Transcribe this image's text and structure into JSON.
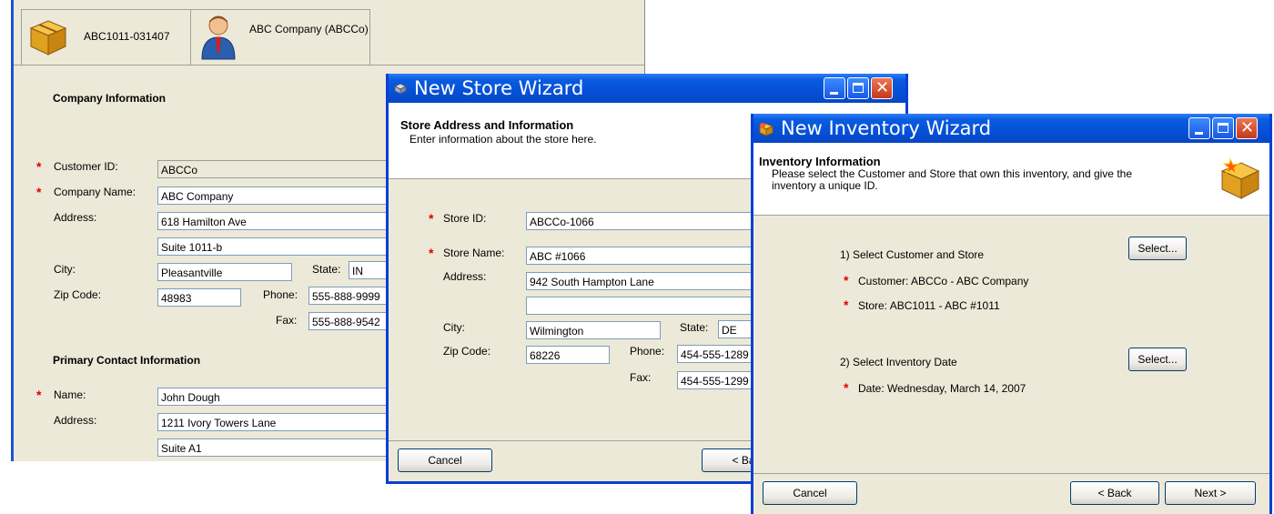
{
  "bg_app": {
    "tabs": [
      {
        "label": "ABC1011-031407",
        "icon": "box-icon"
      },
      {
        "label": "ABC Company (ABCCo)",
        "icon": "person-icon"
      }
    ],
    "company_section": "Company Information",
    "customer_id_label": "Customer ID:",
    "customer_id_value": "ABCCo",
    "company_name_label": "Company Name:",
    "company_name_value": "ABC Company",
    "address_label": "Address:",
    "address1": "618 Hamilton Ave",
    "address2": "Suite 1011-b",
    "city_label": "City:",
    "city_value": "Pleasantville",
    "state_label": "State:",
    "state_value": "IN",
    "zip_label": "Zip Code:",
    "zip_value": "48983",
    "phone_label": "Phone:",
    "phone_value": "555-888-9999",
    "fax_label": "Fax:",
    "fax_value": "555-888-9542",
    "contact_section": "Primary Contact Information",
    "name_label": "Name:",
    "name_value": "John Dough",
    "contact_address_label": "Address:",
    "contact_address1": "1211 Ivory Towers Lane",
    "contact_address2": "Suite A1"
  },
  "store_wizard": {
    "title": "New Store Wizard",
    "header_title": "Store Address and Information",
    "header_subtitle": "Enter information about the store here.",
    "store_id_label": "Store ID:",
    "store_id_value": "ABCCo-1066",
    "store_name_label": "Store Name:",
    "store_name_value": "ABC #1066",
    "address_label": "Address:",
    "address1": "942 South Hampton Lane",
    "address2": "",
    "city_label": "City:",
    "city_value": "Wilmington",
    "state_label": "State:",
    "state_value": "DE",
    "zip_label": "Zip Code:",
    "zip_value": "68226",
    "phone_label": "Phone:",
    "phone_value": "454-555-1289",
    "fax_label": "Fax:",
    "fax_value": "454-555-1299",
    "cancel": "Cancel",
    "back": "< Back"
  },
  "inventory_wizard": {
    "title": "New Inventory Wizard",
    "header_title": "Inventory Information",
    "header_subtitle": "Please select the Customer and Store that own this inventory, and give the inventory a unique ID.",
    "step1": "1) Select Customer and Store",
    "select1": "Select...",
    "customer": "Customer: ABCCo - ABC Company",
    "store": "Store: ABC1011 - ABC #1011",
    "step2": "2) Select Inventory Date",
    "select2": "Select...",
    "date": "Date: Wednesday, March 14, 2007",
    "cancel": "Cancel",
    "back": "< Back",
    "next": "Next >"
  },
  "colors": {
    "titlebar": "#0551d8",
    "required": "#e00000",
    "window_bg": "#ece9d8"
  }
}
